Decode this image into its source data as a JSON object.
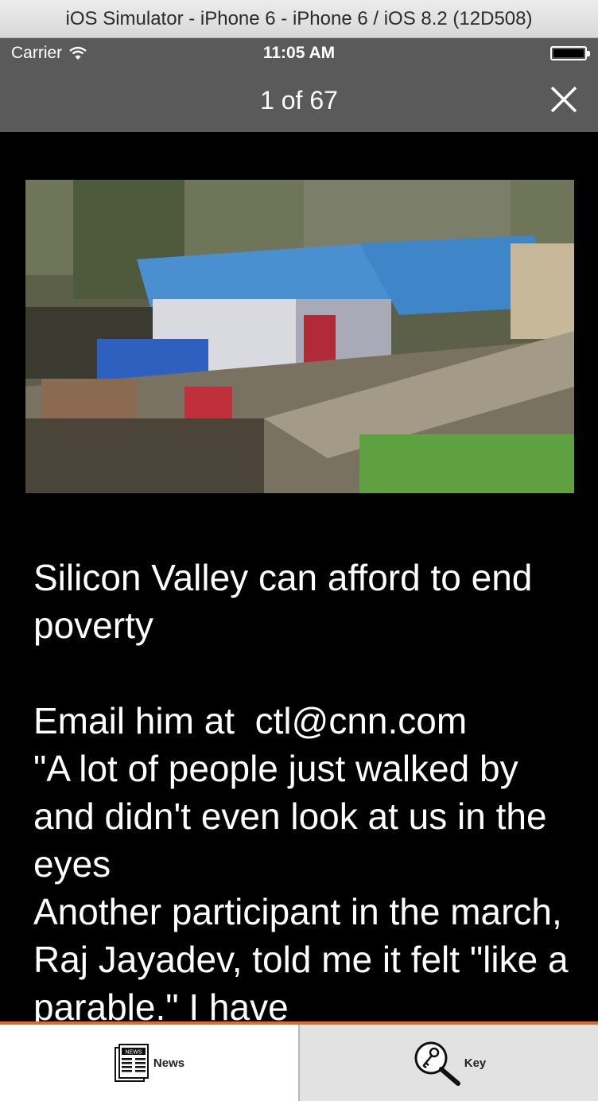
{
  "window": {
    "title": "iOS Simulator - iPhone 6 - iPhone 6 / iOS 8.2 (12D508)"
  },
  "status_bar": {
    "carrier": "Carrier",
    "time": "11:05 AM"
  },
  "nav": {
    "title": "1 of 67",
    "close_icon": "close-icon"
  },
  "article": {
    "image_icon": "photo",
    "text": "Silicon Valley can afford to end poverty\n\nEmail him at  ctl@cnn.com\n\"A lot of people just walked by and didn't even look at us in the eyes\nAnother participant in the march, Raj Jayadev, told me it felt \"like a parable.\" I have"
  },
  "tabs": [
    {
      "label": "News",
      "icon": "newspaper-icon",
      "icon_text": "NEWS",
      "selected": true
    },
    {
      "label": "Key",
      "icon": "key-magnifier-icon",
      "selected": false
    }
  ],
  "colors": {
    "bar": "#5a5a5a",
    "tab_accent": "#e06a2a",
    "background": "#000000"
  }
}
